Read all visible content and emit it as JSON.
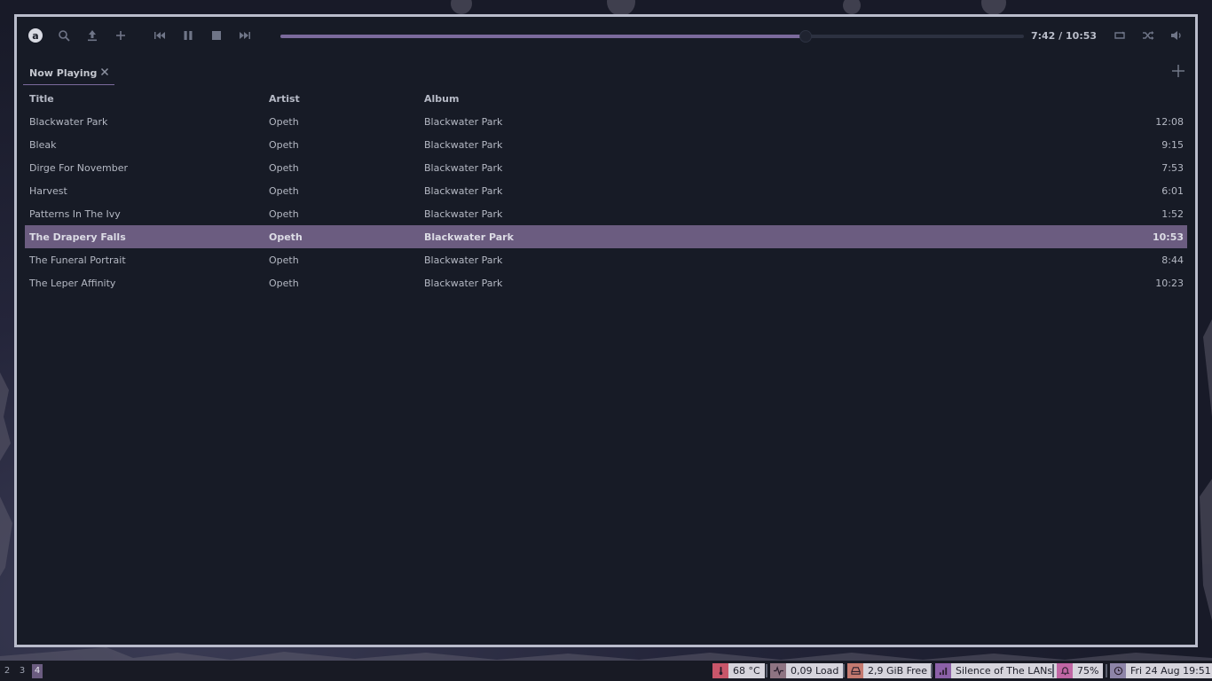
{
  "toolbar": {
    "logo_letter": "a",
    "time_elapsed": "7:42",
    "time_separator": " / ",
    "time_total": "10:53",
    "progress": 0.706,
    "icons": [
      "search-icon",
      "upload-icon",
      "add-icon",
      "previous-icon",
      "pause-icon",
      "stop-icon",
      "next-icon",
      "repeat-icon",
      "shuffle-icon",
      "volume-icon"
    ]
  },
  "tabs": [
    {
      "label": "Now Playing"
    }
  ],
  "table": {
    "headers": {
      "title": "Title",
      "artist": "Artist",
      "album": "Album"
    },
    "rows": [
      {
        "title": "Blackwater Park",
        "artist": "Opeth",
        "album": "Blackwater Park",
        "length": "12:08"
      },
      {
        "title": "Bleak",
        "artist": "Opeth",
        "album": "Blackwater Park",
        "length": "9:15"
      },
      {
        "title": "Dirge For November",
        "artist": "Opeth",
        "album": "Blackwater Park",
        "length": "7:53"
      },
      {
        "title": "Harvest",
        "artist": "Opeth",
        "album": "Blackwater Park",
        "length": "6:01"
      },
      {
        "title": "Patterns In The Ivy",
        "artist": "Opeth",
        "album": "Blackwater Park",
        "length": "1:52"
      },
      {
        "title": "The Drapery Falls",
        "artist": "Opeth",
        "album": "Blackwater Park",
        "length": "10:53",
        "selected": true
      },
      {
        "title": "The Funeral Portrait",
        "artist": "Opeth",
        "album": "Blackwater Park",
        "length": "8:44"
      },
      {
        "title": "The Leper Affinity",
        "artist": "Opeth",
        "album": "Blackwater Park",
        "length": "10:23"
      }
    ]
  },
  "panel": {
    "workspaces": [
      {
        "label": "2",
        "active": false
      },
      {
        "label": "3",
        "active": false
      },
      {
        "label": "4",
        "active": true
      }
    ],
    "widgets": {
      "temperature": "68 °C",
      "load": "0,09 Load",
      "disk": "2,9 GiB Free",
      "network": "Silence of The LANs",
      "volume": "75%",
      "clock": "Fri 24 Aug 19:51"
    },
    "colors": {
      "temperature": "#c8566a",
      "load": "#8e7482",
      "disk": "#c57a70",
      "network": "#8c61a8",
      "volume": "#c066a4",
      "clock": "#8d84a8"
    }
  },
  "colors": {
    "accent": "#7b6a9c",
    "selected_row": "#6b5c80",
    "window_bg": "#171b26",
    "window_border": "#b9bccb"
  }
}
